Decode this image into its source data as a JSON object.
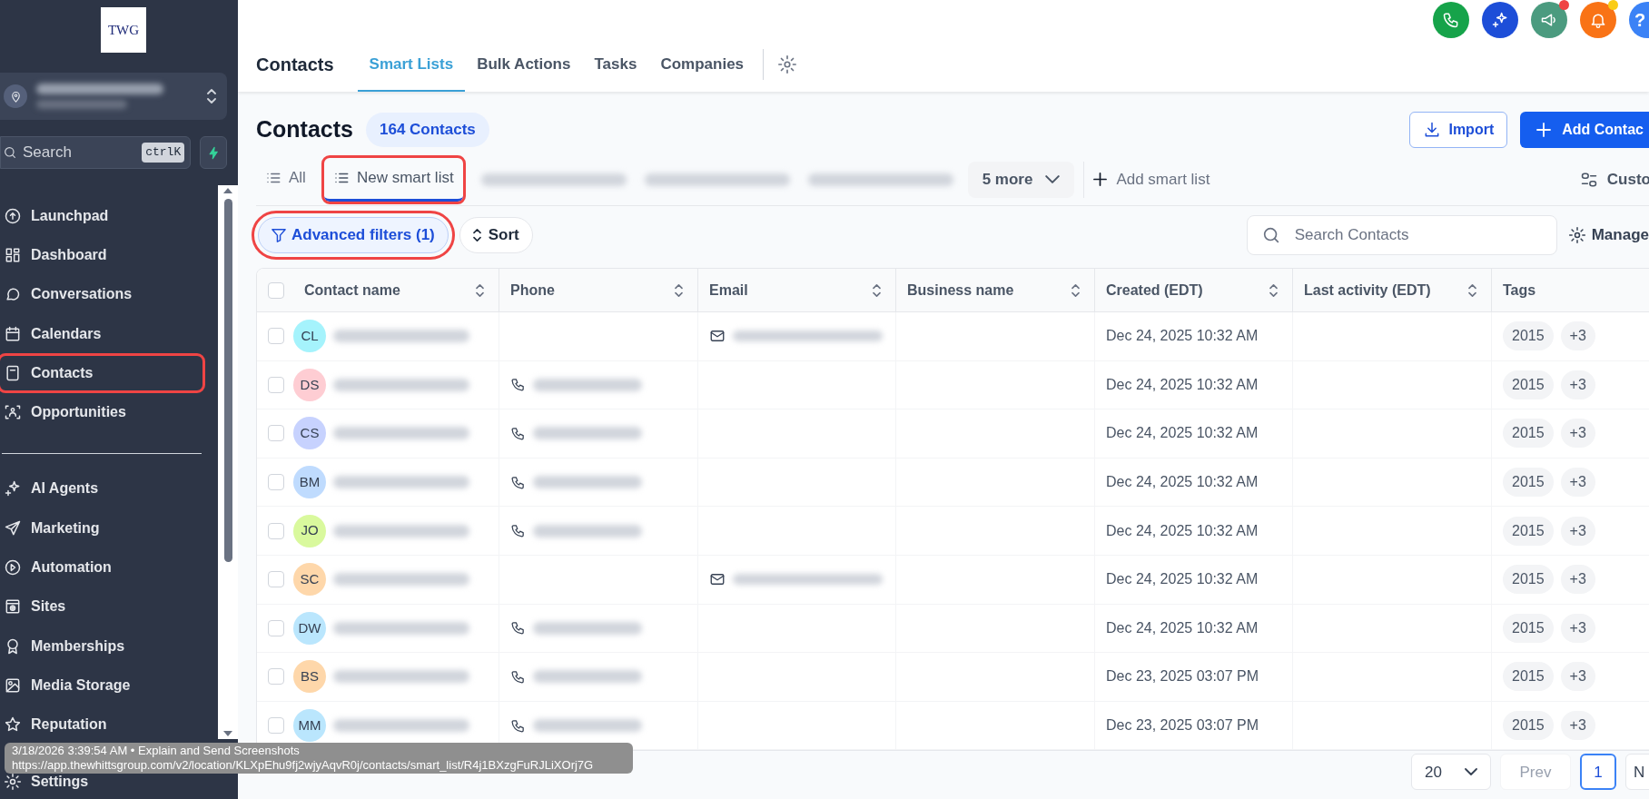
{
  "sidebar": {
    "logo": "TWG",
    "account": {
      "name_redacted": true
    },
    "search": {
      "placeholder": "Search",
      "shortcut": "ctrlK"
    },
    "items": [
      {
        "label": "Launchpad",
        "kind": "launchpad",
        "highlighted": false
      },
      {
        "label": "Dashboard",
        "kind": "dashboard",
        "highlighted": false
      },
      {
        "label": "Conversations",
        "kind": "chat",
        "highlighted": false
      },
      {
        "label": "Calendars",
        "kind": "calendar",
        "highlighted": false
      },
      {
        "label": "Contacts",
        "kind": "contacts",
        "highlighted": true
      },
      {
        "label": "Opportunities",
        "kind": "opportunities",
        "highlighted": false
      },
      {
        "label": "AI Agents",
        "kind": "sparkle",
        "highlighted": false,
        "divider_before": true
      },
      {
        "label": "Marketing",
        "kind": "send",
        "highlighted": false
      },
      {
        "label": "Automation",
        "kind": "play",
        "highlighted": false
      },
      {
        "label": "Sites",
        "kind": "sites",
        "highlighted": false
      },
      {
        "label": "Memberships",
        "kind": "award",
        "highlighted": false
      },
      {
        "label": "Media Storage",
        "kind": "image",
        "highlighted": false
      },
      {
        "label": "Reputation",
        "kind": "star",
        "highlighted": false
      },
      {
        "label": "Settings",
        "kind": "gear",
        "highlighted": false
      }
    ]
  },
  "header_buttons": [
    {
      "kind": "phone",
      "color": "#16a34a"
    },
    {
      "kind": "sparkle",
      "color": "#1d4ed8"
    },
    {
      "kind": "megaphone",
      "color": "#4b9b7f",
      "badge": {
        "color": "#ef4444"
      }
    },
    {
      "kind": "bell",
      "color": "#f97316",
      "badge": {
        "color": "#facc15"
      }
    },
    {
      "kind": "help",
      "color": "#3b82f6",
      "glyph": "?"
    }
  ],
  "top_tabs": {
    "title": "Contacts",
    "tabs": [
      {
        "label": "Smart Lists",
        "selected": true
      },
      {
        "label": "Bulk Actions",
        "selected": false
      },
      {
        "label": "Tasks",
        "selected": false
      },
      {
        "label": "Companies",
        "selected": false
      }
    ]
  },
  "page": {
    "title": "Contacts",
    "count": "164 Contacts",
    "import": "Import",
    "add": "Add Contac"
  },
  "smart_lists": {
    "tabs": [
      {
        "kind": "list",
        "label": "All",
        "selected": false,
        "highlighted": false
      },
      {
        "kind": "list",
        "label": "New smart list",
        "selected": true,
        "highlighted": true
      },
      {
        "kind": "redacted"
      },
      {
        "kind": "redacted"
      },
      {
        "kind": "redacted"
      }
    ],
    "more": "5 more",
    "add": "Add smart list",
    "customize": "Custo"
  },
  "filters": {
    "advanced": "Advanced filters (1)",
    "advanced_highlighted": true,
    "sort": "Sort",
    "search_placeholder": "Search Contacts",
    "manage": "Manage"
  },
  "table": {
    "all_checked": false,
    "columns": [
      {
        "label": "Contact name",
        "sortable": true
      },
      {
        "label": "Phone",
        "sortable": true
      },
      {
        "label": "Email",
        "sortable": true
      },
      {
        "label": "Business name",
        "sortable": true
      },
      {
        "label": "Created (EDT)",
        "sortable": true
      },
      {
        "label": "Last activity (EDT)",
        "sortable": true
      },
      {
        "label": "Tags",
        "sortable": false
      }
    ],
    "rows": [
      {
        "checked": false,
        "initials": "CL",
        "color": "#a5f3fc",
        "phone": false,
        "email": true,
        "created": "Dec 24, 2025 10:32 AM",
        "tags": [
          "2015",
          "+3"
        ]
      },
      {
        "checked": false,
        "initials": "DS",
        "color": "#fecdd3",
        "phone": true,
        "email": false,
        "created": "Dec 24, 2025 10:32 AM",
        "tags": [
          "2015",
          "+3"
        ]
      },
      {
        "checked": false,
        "initials": "CS",
        "color": "#c7d2fe",
        "phone": true,
        "email": false,
        "created": "Dec 24, 2025 10:32 AM",
        "tags": [
          "2015",
          "+3"
        ]
      },
      {
        "checked": false,
        "initials": "BM",
        "color": "#bfdbfe",
        "phone": true,
        "email": false,
        "created": "Dec 24, 2025 10:32 AM",
        "tags": [
          "2015",
          "+3"
        ]
      },
      {
        "checked": false,
        "initials": "JO",
        "color": "#d9f99d",
        "phone": true,
        "email": false,
        "created": "Dec 24, 2025 10:32 AM",
        "tags": [
          "2015",
          "+3"
        ]
      },
      {
        "checked": false,
        "initials": "SC",
        "color": "#fed7aa",
        "phone": false,
        "email": true,
        "created": "Dec 24, 2025 10:32 AM",
        "tags": [
          "2015",
          "+3"
        ]
      },
      {
        "checked": false,
        "initials": "DW",
        "color": "#bae6fd",
        "phone": true,
        "email": false,
        "created": "Dec 24, 2025 10:32 AM",
        "tags": [
          "2015",
          "+3"
        ]
      },
      {
        "checked": false,
        "initials": "BS",
        "color": "#fed7aa",
        "phone": true,
        "email": false,
        "created": "Dec 23, 2025 03:07 PM",
        "tags": [
          "2015",
          "+3"
        ]
      },
      {
        "checked": false,
        "initials": "MM",
        "color": "#bae6fd",
        "phone": true,
        "email": false,
        "created": "Dec 23, 2025 03:07 PM",
        "tags": [
          "2015",
          "+3"
        ]
      }
    ]
  },
  "pagination": {
    "page_size": "20",
    "prev": "Prev",
    "prev_disabled": true,
    "pages": [
      {
        "label": "1",
        "selected": true
      }
    ],
    "next": "N"
  },
  "tooltip": {
    "line": "3/18/2026 3:39:54 AM • Explain and Send Screenshots",
    "url": "https://app.thewhittsgroup.com/v2/location/KLXpEhu9fj2wjyAqvR0j/contacts/smart_list/R4j1BXzgFuRJLiXOrj7G"
  }
}
